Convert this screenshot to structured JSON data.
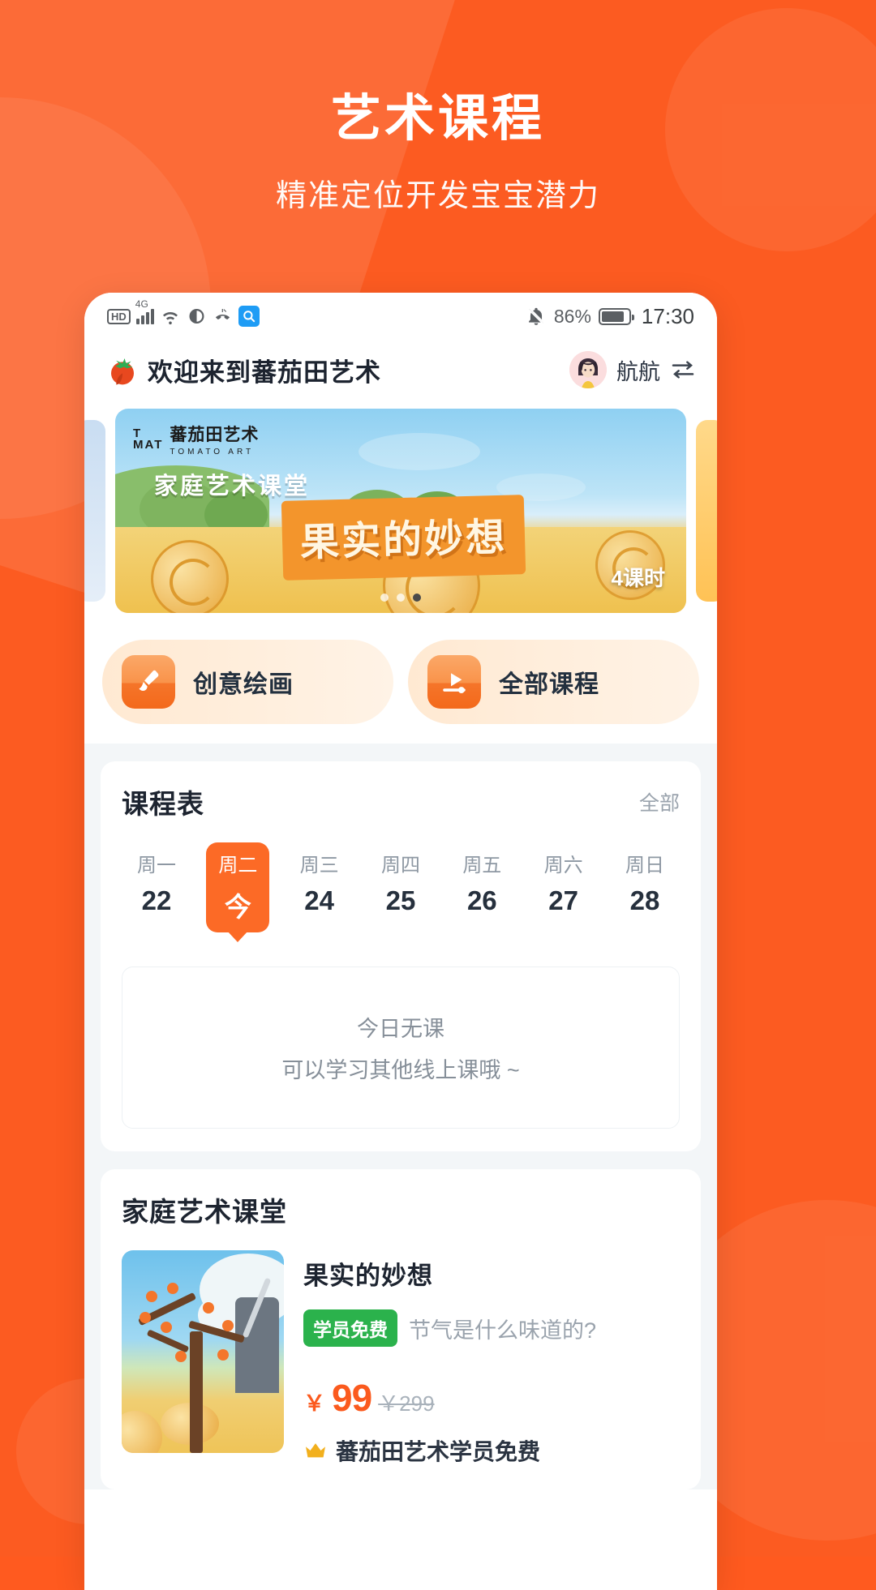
{
  "promo": {
    "title": "艺术课程",
    "subtitle": "精准定位开发宝宝潜力"
  },
  "statusbar": {
    "hd_label": "HD",
    "network_label": "4G",
    "battery_percent": "86%",
    "time": "17:30",
    "icons": [
      "hd-icon",
      "signal-4g-icon",
      "wifi-icon",
      "eye-care-icon",
      "missed-call-icon",
      "search-icon",
      "mute-bell-icon",
      "battery-icon"
    ]
  },
  "appbar": {
    "title": "欢迎来到蕃茄田艺术",
    "logo_icon": "tomato-icon",
    "user_name": "航航",
    "switch_icon": "switch-account-icon"
  },
  "banner": {
    "brand_cn": "蕃茄田艺术",
    "brand_en": "TOMATO ART",
    "brand_mark_top": "T",
    "brand_mark_mid": "MAT",
    "subtitle": "家庭艺术课堂",
    "main_title": "果实的妙想",
    "lessons": "4课时",
    "dots_total": 3,
    "dots_active_index": 2
  },
  "quick_actions": [
    {
      "label": "创意绘画",
      "icon": "paint-brush-icon"
    },
    {
      "label": "全部课程",
      "icon": "video-play-icon"
    }
  ],
  "schedule": {
    "title": "课程表",
    "more_label": "全部",
    "days": [
      {
        "dow": "周一",
        "num": "22",
        "active": false
      },
      {
        "dow": "周二",
        "num": "今",
        "active": true
      },
      {
        "dow": "周三",
        "num": "24",
        "active": false
      },
      {
        "dow": "周四",
        "num": "25",
        "active": false
      },
      {
        "dow": "周五",
        "num": "26",
        "active": false
      },
      {
        "dow": "周六",
        "num": "27",
        "active": false
      },
      {
        "dow": "周日",
        "num": "28",
        "active": false
      }
    ],
    "empty_line1": "今日无课",
    "empty_line2": "可以学习其他线上课哦 ~"
  },
  "family_class": {
    "title": "家庭艺术课堂",
    "course": {
      "name": "果实的妙想",
      "tag": "学员免费",
      "desc": "节气是什么味道的?",
      "currency": "￥",
      "price": "99",
      "price_old": "￥299",
      "perk_icon": "crown-icon",
      "perk_text": "蕃茄田艺术学员免费"
    }
  },
  "colors": {
    "brand_orange": "#FC5B21",
    "accent_orange": "#FC6A26",
    "green_tag": "#2BB24C",
    "price_red": "#FB5A1E",
    "muted": "#9AA3AD"
  }
}
